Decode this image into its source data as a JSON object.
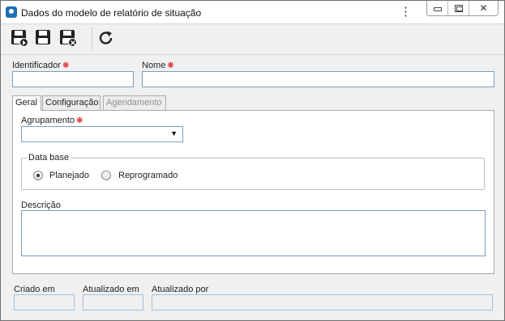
{
  "window": {
    "title": "Dados do modelo de relatório de situação",
    "menu_icon": "⋮",
    "controls": {
      "minimize": "minimize-icon",
      "maximize": "maximize-icon",
      "close": "✕"
    }
  },
  "toolbar": {
    "buttons": [
      {
        "name": "save-and-new",
        "icon": "save-new-icon"
      },
      {
        "name": "save",
        "icon": "save-icon"
      },
      {
        "name": "save-and-close",
        "icon": "save-close-icon"
      },
      {
        "name": "refresh",
        "icon": "refresh-icon"
      }
    ]
  },
  "form": {
    "identificador": {
      "label": "Identificador",
      "value": "",
      "required_mark": "❋"
    },
    "nome": {
      "label": "Nome",
      "value": "",
      "required_mark": "❋"
    }
  },
  "tabs": [
    {
      "label": "Geral",
      "state": "active"
    },
    {
      "label": "Configuração",
      "state": "enabled"
    },
    {
      "label": "Agendamento",
      "state": "disabled"
    }
  ],
  "geral": {
    "agrupamento": {
      "label": "Agrupamento",
      "value": "",
      "required_mark": "❋",
      "caret": "▼"
    },
    "data_base": {
      "legend": "Data base",
      "options": [
        {
          "label": "Planejado",
          "checked": true
        },
        {
          "label": "Reprogramado",
          "checked": false
        }
      ]
    },
    "descricao": {
      "label": "Descrição",
      "value": ""
    }
  },
  "footer": {
    "criado_em": {
      "label": "Criado em",
      "value": ""
    },
    "atualizado_em": {
      "label": "Atualizado em",
      "value": ""
    },
    "atualizado_por": {
      "label": "Atualizado por",
      "value": ""
    }
  },
  "colors": {
    "accent": "#1f6fb5",
    "required": "#dd1111",
    "field_border": "#7a9cc0"
  }
}
